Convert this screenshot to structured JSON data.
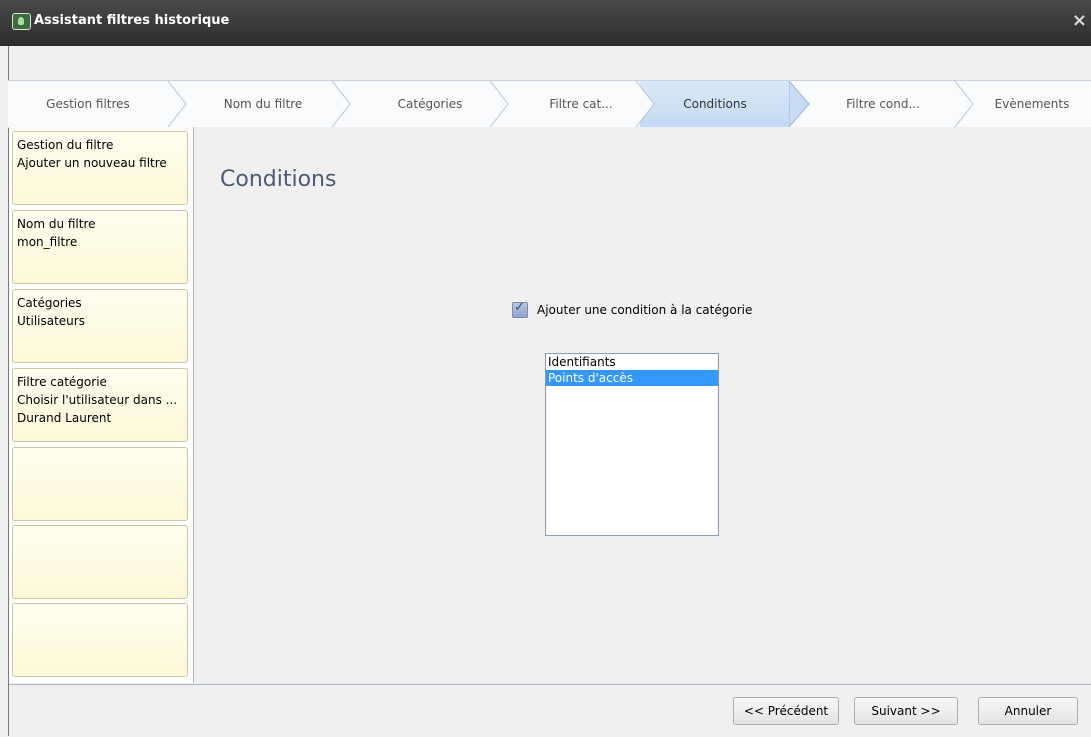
{
  "window": {
    "title": "Assistant filtres historique",
    "close_label": "×"
  },
  "steps": [
    {
      "label": "Gestion filtres"
    },
    {
      "label": "Nom du filtre"
    },
    {
      "label": "Catégories"
    },
    {
      "label": "Filtre cat..."
    },
    {
      "label": "Conditions",
      "active": true
    },
    {
      "label": "Filtre cond..."
    },
    {
      "label": "Evènements"
    }
  ],
  "sidebar": {
    "cards": [
      {
        "lines": [
          "Gestion du filtre",
          "Ajouter un nouveau filtre"
        ]
      },
      {
        "lines": [
          "Nom du filtre",
          "mon_filtre"
        ]
      },
      {
        "lines": [
          "Catégories",
          "Utilisateurs"
        ]
      },
      {
        "lines": [
          "Filtre catégorie",
          "Choisir l'utilisateur dans ...",
          "Durand Laurent"
        ]
      },
      {
        "lines": []
      },
      {
        "lines": []
      },
      {
        "lines": []
      }
    ]
  },
  "main": {
    "heading": "Conditions",
    "checkbox_label": "Ajouter une condition à la catégorie",
    "checkbox_checked": true,
    "list_items": [
      "Identifiants",
      "Points d'accès"
    ],
    "list_selected_index": 1
  },
  "buttons": {
    "previous": "<< Précédent",
    "next": "Suivant >>",
    "cancel": "Annuler"
  },
  "colors": {
    "active_step": "#c4daf3",
    "selection": "#3399ff",
    "card_bg": "#fdf8d7"
  }
}
